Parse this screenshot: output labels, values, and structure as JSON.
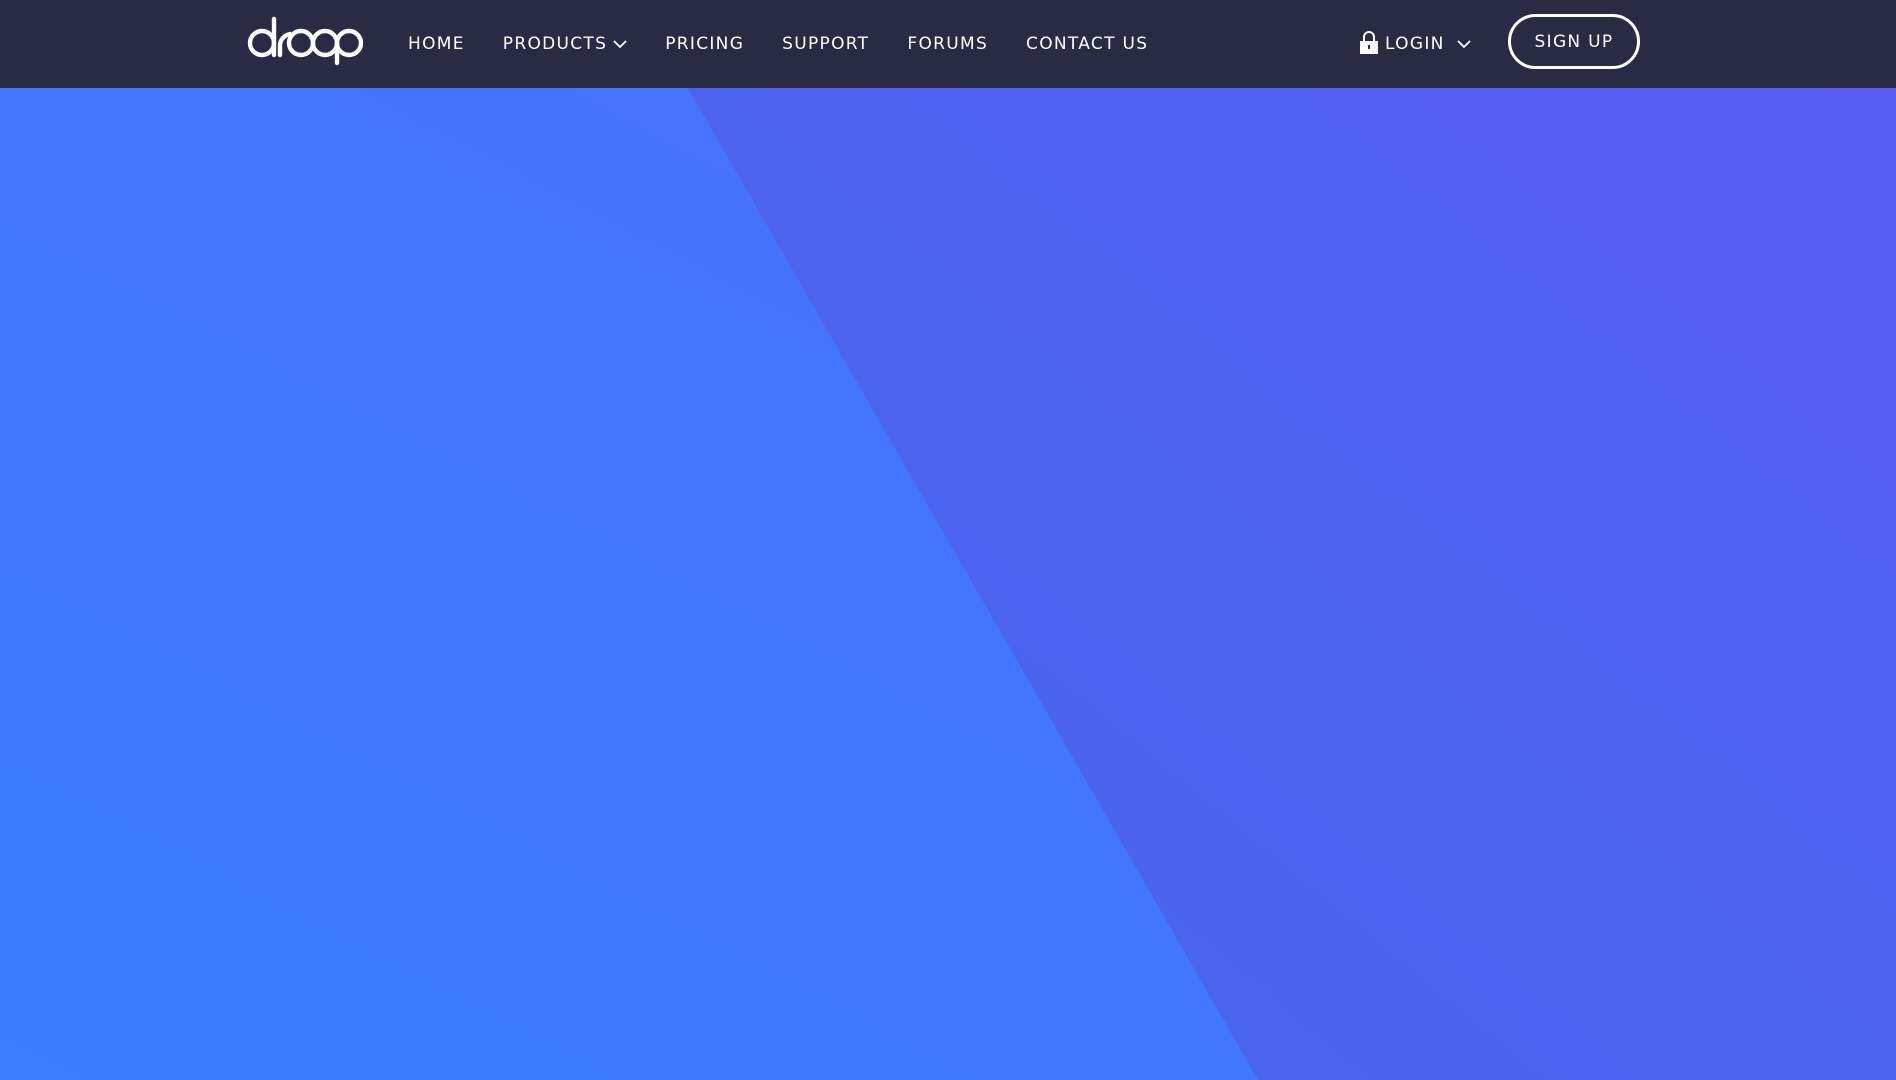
{
  "brand": {
    "logo_text": "droop"
  },
  "nav": {
    "items": [
      {
        "label": "HOME"
      },
      {
        "label": "PRODUCTS",
        "has_dropdown": true
      },
      {
        "label": "PRICING"
      },
      {
        "label": "SUPPORT"
      },
      {
        "label": "FORUMS"
      },
      {
        "label": "CONTACT US"
      }
    ]
  },
  "account": {
    "login_label": "LOGIN",
    "login_icon": "lock-icon",
    "signup_label": "SIGN UP"
  },
  "colors": {
    "navbar_bg": "#292a44",
    "hero_left": "#3d7bff",
    "hero_right": "#565af0",
    "text": "#ffffff"
  }
}
